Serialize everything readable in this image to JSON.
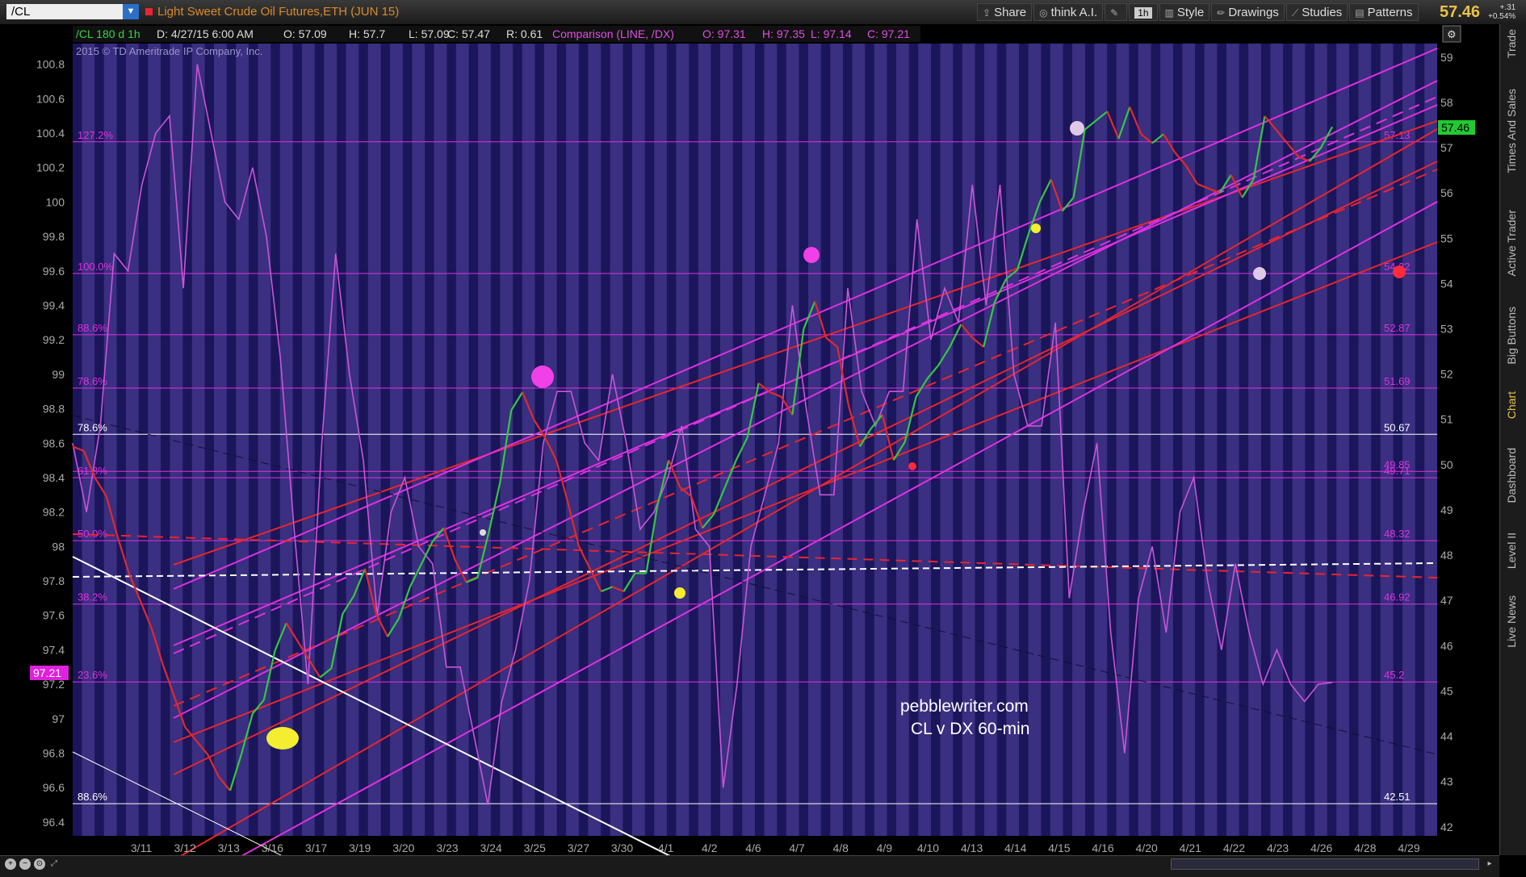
{
  "header": {
    "symbol": "/CL",
    "title": "Light Sweet Crude Oil Futures,ETH (JUN 15)",
    "share_label": "Share",
    "think_ai_label": "think A.I.",
    "timeframe_label": "1h",
    "style_label": "Style",
    "drawings_label": "Drawings",
    "studies_label": "Studies",
    "patterns_label": "Patterns",
    "last_price": "57.46",
    "change_abs": "+.31",
    "change_pct": "+0.54%"
  },
  "infobar": {
    "symbol_period": "/CL 180 d 1h",
    "date": "D: 4/27/15 6:00 AM",
    "open": "O: 57.09",
    "high": "H: 57.7",
    "low": "L: 57.09",
    "close": "C: 57.47",
    "r": "R: 0.61",
    "comparison": "Comparison (LINE, /DX)",
    "cmp_open": "O: 97.31",
    "cmp_high": "H: 97.35",
    "cmp_low": "L: 97.14",
    "cmp_close": "C: 97.21"
  },
  "copyright": "2015 © TD Ameritrade IP Company, Inc.",
  "annotation": {
    "line1": "pebblewriter.com",
    "line2": "CL v DX 60-min"
  },
  "sidebar_tabs": [
    "Trade",
    "Times And Sales",
    "Active Trader",
    "Big Buttons",
    "Chart",
    "Dashboard",
    "Level II",
    "Live News"
  ],
  "sidebar_active": "Chart",
  "left_price_marker": "97.21",
  "right_price_marker": "57.46",
  "colors": {
    "background": "#3a2f80",
    "night_band": "#1b155a",
    "candle_up": "#35c742",
    "candle_down": "#e0292e",
    "comparison_line": "#c955d8",
    "fib_line": "#e030e0",
    "channel_red": "#e8252f",
    "channel_magenta": "#e030e0",
    "price_badge_green": "#22c933",
    "price_badge_magenta": "#e020e0"
  },
  "chart_data": {
    "type": "line",
    "title": "Light Sweet Crude Oil Futures,ETH (JUN 15)",
    "xlabel": "",
    "ylabel": "",
    "x_ticks": [
      "3/11",
      "3/12",
      "3/13",
      "3/16",
      "3/17",
      "3/19",
      "3/20",
      "3/23",
      "3/24",
      "3/25",
      "3/27",
      "3/30",
      "4/1",
      "4/2",
      "4/6",
      "4/7",
      "4/8",
      "4/9",
      "4/10",
      "4/13",
      "4/14",
      "4/15",
      "4/16",
      "4/20",
      "4/21",
      "4/22",
      "4/23",
      "4/26",
      "4/28",
      "4/29"
    ],
    "y_left_ticks": [
      "100.8",
      "100.6",
      "100.4",
      "100.2",
      "100",
      "99.8",
      "99.6",
      "99.4",
      "99.2",
      "99",
      "98.8",
      "98.6",
      "98.4",
      "98.2",
      "98",
      "97.8",
      "97.6",
      "97.4",
      "97.2",
      "97",
      "96.8",
      "96.6",
      "96.4"
    ],
    "y_right_ticks": [
      "59",
      "58",
      "57",
      "56",
      "55",
      "54",
      "53",
      "52",
      "51",
      "50",
      "49",
      "48",
      "47",
      "46",
      "45",
      "44",
      "43",
      "42"
    ],
    "ylim_left": [
      96.32,
      100.92
    ],
    "ylim_right": [
      41.8,
      59.3
    ],
    "grid": false,
    "fib_levels_right": [
      {
        "pct": "127.2%",
        "value": "57.13"
      },
      {
        "pct": "100.0%",
        "value": "54.22"
      },
      {
        "pct": "88.6%",
        "value": "52.87"
      },
      {
        "pct": "78.6%",
        "value": "51.69"
      },
      {
        "pct": "61.8%",
        "value": "49.71"
      },
      {
        "pct": "",
        "value": "49.85"
      },
      {
        "pct": "50.0%",
        "value": "48.32"
      },
      {
        "pct": "38.2%",
        "value": "46.92"
      },
      {
        "pct": "23.6%",
        "value": "45.2"
      }
    ],
    "white_levels": [
      {
        "pct": "78.6%",
        "value": "50.67"
      },
      {
        "pct": "88.6%",
        "value": "42.51"
      }
    ],
    "series": [
      {
        "name": "/CL",
        "axis": "right",
        "values": [
          50.4,
          50.3,
          49.7,
          49.3,
          48.4,
          47.6,
          47.0,
          46.4,
          45.6,
          44.9,
          44.2,
          43.9,
          43.6,
          43.1,
          42.8,
          43.6,
          44.5,
          44.8,
          45.9,
          46.5,
          46.1,
          45.7,
          45.3,
          45.5,
          46.7,
          47.1,
          47.7,
          46.7,
          46.2,
          46.6,
          47.3,
          47.8,
          48.3,
          48.6,
          47.9,
          47.4,
          47.5,
          48.5,
          49.6,
          51.2,
          51.6,
          51.0,
          50.6,
          50.1,
          49.2,
          48.2,
          47.7,
          47.2,
          47.3,
          47.2,
          47.6,
          47.6,
          49.1,
          50.1,
          49.5,
          49.3,
          48.6,
          48.9,
          49.5,
          50.1,
          50.6,
          51.8,
          51.6,
          51.5,
          51.1,
          53.0,
          53.6,
          52.8,
          52.6,
          51.3,
          50.4,
          50.8,
          51.1,
          50.1,
          50.5,
          51.5,
          51.9,
          52.2,
          52.6,
          53.1,
          52.8,
          52.6,
          53.6,
          54.1,
          54.3,
          55.1,
          55.8,
          56.3,
          55.6,
          55.9,
          57.4,
          57.6,
          57.8,
          57.2,
          57.9,
          57.3,
          57.1,
          57.3,
          56.9,
          56.6,
          56.2,
          56.1,
          56.0,
          56.4,
          55.9,
          56.3,
          57.7,
          57.4,
          57.1,
          56.8,
          56.7,
          57.0,
          57.46
        ]
      },
      {
        "name": "/DX",
        "axis": "left",
        "values": [
          98.6,
          98.2,
          98.7,
          99.7,
          99.6,
          100.1,
          100.4,
          100.5,
          99.5,
          100.8,
          100.4,
          100.0,
          99.9,
          100.2,
          99.8,
          99.1,
          98.1,
          97.2,
          98.6,
          99.7,
          99.0,
          98.5,
          97.6,
          98.2,
          98.4,
          98.0,
          97.9,
          97.3,
          97.3,
          96.9,
          96.5,
          97.1,
          97.4,
          97.8,
          98.6,
          98.9,
          98.9,
          98.6,
          98.5,
          99.0,
          98.6,
          98.1,
          98.2,
          98.4,
          98.7,
          98.1,
          98.0,
          96.6,
          97.2,
          98.0,
          98.3,
          98.6,
          99.4,
          98.8,
          98.3,
          98.3,
          99.5,
          98.9,
          98.7,
          98.9,
          98.9,
          99.9,
          99.2,
          99.5,
          99.3,
          100.1,
          99.4,
          100.1,
          99.0,
          98.7,
          98.7,
          99.3,
          97.7,
          98.2,
          98.6,
          97.5,
          96.8,
          97.7,
          98.0,
          97.5,
          98.2,
          98.4,
          97.8,
          97.4,
          97.9,
          97.5,
          97.2,
          97.4,
          97.2,
          97.1,
          97.2,
          97.21
        ]
      }
    ]
  }
}
